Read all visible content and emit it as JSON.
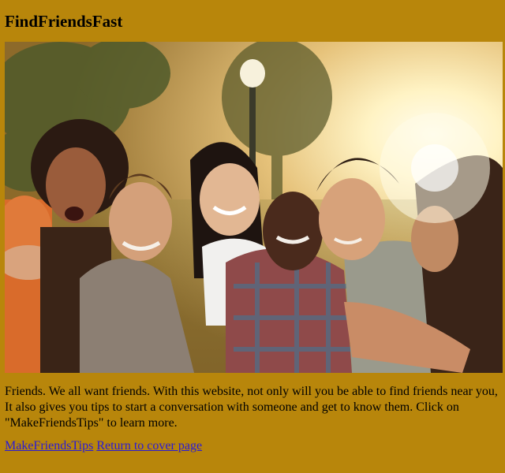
{
  "header": {
    "title": "FindFriendsFast"
  },
  "hero": {
    "image": "group-of-friends-photo"
  },
  "main": {
    "intro_text": "Friends. We all want friends. With this website, not only will you be able to find friends near you, It also gives you tips to start a conversation with someone and get to know them. Click on \"MakeFriendsTips\" to learn more."
  },
  "links": {
    "tips_label": "MakeFriendsTips",
    "cover_label": "Return to cover page"
  },
  "colors": {
    "background": "#b8860b",
    "link": "#2a1ad6"
  }
}
